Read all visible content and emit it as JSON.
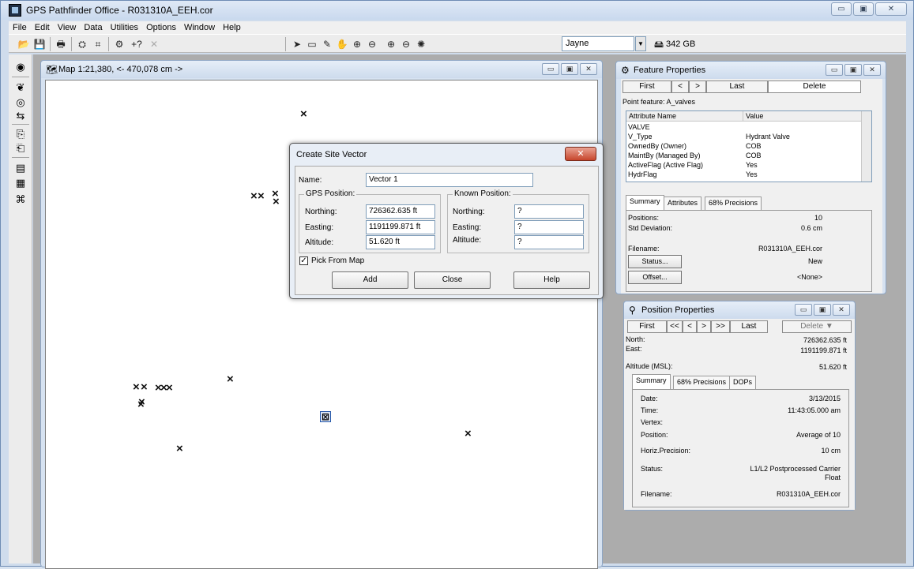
{
  "app": {
    "title": "GPS Pathfinder Office - R031310A_EEH.cor",
    "window_buttons": [
      "▭",
      "▣",
      "✕"
    ]
  },
  "menu": [
    "File",
    "Edit",
    "View",
    "Data",
    "Utilities",
    "Options",
    "Window",
    "Help"
  ],
  "toolbar": {
    "user": "Jayne",
    "disk": "342 GB"
  },
  "map": {
    "title": "Map 1:21,380, <- 470,078 cm ->",
    "marker_glyph": "×",
    "selected_glyph": "⊠"
  },
  "dialog": {
    "title": "Create Site Vector",
    "close_label": "✕",
    "name_label": "Name:",
    "name_value": "Vector 1",
    "gps_group": "GPS Position:",
    "known_group": "Known Position:",
    "northing_label": "Northing:",
    "easting_label": "Easting:",
    "altitude_label": "Altitude:",
    "gps_northing": "726362.635 ft",
    "gps_easting": "1191199.871 ft",
    "gps_altitude": "51.620 ft",
    "known_northing": "?",
    "known_easting": "?",
    "known_altitude": "?",
    "pick_label": "Pick From Map",
    "pick_checked": "✓",
    "add_label": "Add",
    "close_btn_label": "Close",
    "help_label": "Help"
  },
  "feature": {
    "title": "Feature Properties",
    "first": "First",
    "prev": "<",
    "next": ">",
    "last": "Last",
    "delete": "Delete",
    "feature_line": "Point feature: A_valves",
    "col_name": "Attribute Name",
    "col_value": "Value",
    "rows": [
      {
        "name": "VALVE",
        "value": ""
      },
      {
        "name": "V_Type",
        "value": "Hydrant Valve"
      },
      {
        "name": "OwnedBy (Owner)",
        "value": "COB"
      },
      {
        "name": "MaintBy (Managed By)",
        "value": "COB"
      },
      {
        "name": "ActiveFlag (Active Flag)",
        "value": "Yes"
      },
      {
        "name": "HydrFlag",
        "value": "Yes"
      }
    ],
    "tabs": [
      "Summary",
      "Attributes",
      "68% Precisions"
    ],
    "positions_label": "Positions:",
    "positions_value": "10",
    "stddev_label": "Std Deviation:",
    "stddev_value": "0.6 cm",
    "filename_label": "Filename:",
    "filename_value": "R031310A_EEH.cor",
    "status_btn": "Status...",
    "status_value": "New",
    "offset_btn": "Offset...",
    "offset_value": "<None>"
  },
  "position": {
    "title": "Position Properties",
    "first": "First",
    "prevprev": "<<",
    "prev": "<",
    "next": ">",
    "nextnext": ">>",
    "last": "Last",
    "delete": "Delete",
    "north_label": "North:",
    "north_value": "726362.635 ft",
    "east_label": "East:",
    "east_value": "1191199.871 ft",
    "alt_label": "Altitude (MSL):",
    "alt_value": "51.620 ft",
    "tabs": [
      "Summary",
      "68% Precisions",
      "DOPs"
    ],
    "date_label": "Date:",
    "date_value": "3/13/2015",
    "time_label": "Time:",
    "time_value": "11:43:05.000 am",
    "vertex_label": "Vertex:",
    "position_label": "Position:",
    "position_value": "Average of 10",
    "hprec_label": "Horiz.Precision:",
    "hprec_value": "10 cm",
    "status_label": "Status:",
    "status_value_1": "L1/L2 Postprocessed Carrier",
    "status_value_2": "Float",
    "filename_label": "Filename:",
    "filename_value": "R031310A_EEH.cor"
  }
}
